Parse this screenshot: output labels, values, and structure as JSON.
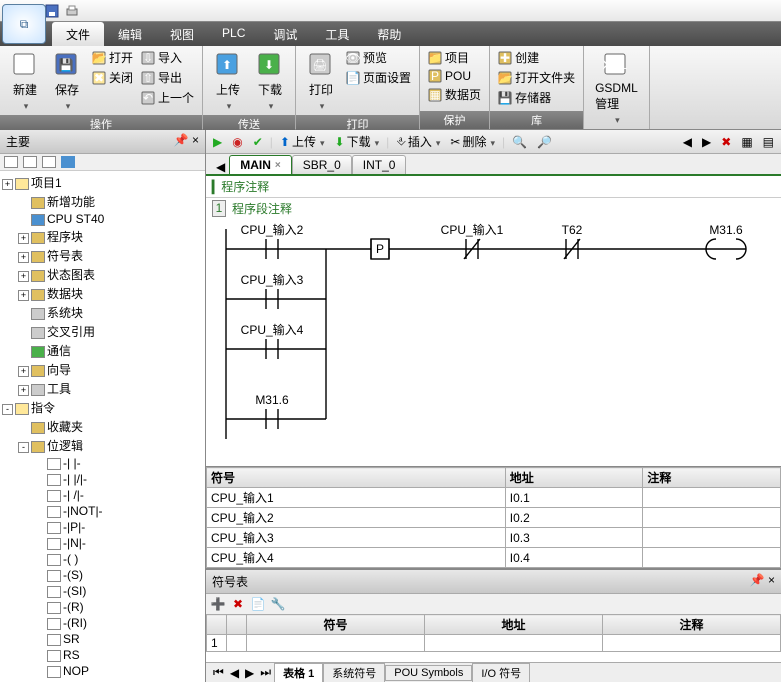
{
  "qa": {
    "app_logo": "⧉"
  },
  "menu": {
    "tabs": [
      "文件",
      "编辑",
      "视图",
      "PLC",
      "调试",
      "工具",
      "帮助"
    ],
    "active": 0
  },
  "ribbon": {
    "groups": [
      {
        "title": "操作",
        "big": [
          {
            "id": "new",
            "label": "新建"
          },
          {
            "id": "save",
            "label": "保存"
          }
        ],
        "col1": [
          {
            "id": "open",
            "label": "打开"
          },
          {
            "id": "close",
            "label": "关闭"
          }
        ],
        "col2": [
          {
            "id": "import",
            "label": "导入"
          },
          {
            "id": "export",
            "label": "导出"
          },
          {
            "id": "prev",
            "label": "上一个"
          }
        ]
      },
      {
        "title": "传送",
        "big": [
          {
            "id": "upload",
            "label": "上传"
          },
          {
            "id": "download",
            "label": "下载"
          }
        ]
      },
      {
        "title": "打印",
        "big": [
          {
            "id": "print",
            "label": "打印"
          }
        ],
        "col": [
          {
            "id": "preview",
            "label": "预览"
          },
          {
            "id": "page",
            "label": "页面设置"
          }
        ]
      },
      {
        "title": "保护",
        "col": [
          {
            "id": "project",
            "label": "项目"
          },
          {
            "id": "pou",
            "label": "POU"
          },
          {
            "id": "datapage",
            "label": "数据页"
          }
        ]
      },
      {
        "title": "库",
        "col": [
          {
            "id": "create",
            "label": "创建"
          },
          {
            "id": "openfolder",
            "label": "打开文件夹"
          },
          {
            "id": "storage",
            "label": "存储器"
          }
        ]
      },
      {
        "title": "GSDML",
        "big": [
          {
            "id": "gsdml",
            "label": "GSDML\n管理"
          }
        ]
      }
    ]
  },
  "left": {
    "title": "主要",
    "tree": [
      {
        "d": 0,
        "t": "+",
        "ic": "folder",
        "label": "项目1"
      },
      {
        "d": 1,
        "t": "",
        "ic": "star",
        "label": "新增功能"
      },
      {
        "d": 1,
        "t": "",
        "ic": "cpu",
        "label": "CPU ST40"
      },
      {
        "d": 1,
        "t": "+",
        "ic": "blk",
        "label": "程序块"
      },
      {
        "d": 1,
        "t": "+",
        "ic": "blk",
        "label": "符号表"
      },
      {
        "d": 1,
        "t": "+",
        "ic": "blk",
        "label": "状态图表"
      },
      {
        "d": 1,
        "t": "+",
        "ic": "blk",
        "label": "数据块"
      },
      {
        "d": 1,
        "t": "",
        "ic": "grid",
        "label": "系统块"
      },
      {
        "d": 1,
        "t": "",
        "ic": "xref",
        "label": "交叉引用"
      },
      {
        "d": 1,
        "t": "",
        "ic": "comm",
        "label": "通信"
      },
      {
        "d": 1,
        "t": "+",
        "ic": "wiz",
        "label": "向导"
      },
      {
        "d": 1,
        "t": "+",
        "ic": "tool",
        "label": "工具"
      },
      {
        "d": 0,
        "t": "-",
        "ic": "folder",
        "label": "指令"
      },
      {
        "d": 1,
        "t": "",
        "ic": "fav",
        "label": "收藏夹"
      },
      {
        "d": 1,
        "t": "-",
        "ic": "fold2",
        "label": "位逻辑"
      },
      {
        "d": 2,
        "t": "",
        "ic": "inst",
        "label": "-| |-"
      },
      {
        "d": 2,
        "t": "",
        "ic": "inst",
        "label": "-| |/|-"
      },
      {
        "d": 2,
        "t": "",
        "ic": "inst",
        "label": "-| /|-"
      },
      {
        "d": 2,
        "t": "",
        "ic": "inst",
        "label": "-|NOT|-"
      },
      {
        "d": 2,
        "t": "",
        "ic": "inst",
        "label": "-|P|-"
      },
      {
        "d": 2,
        "t": "",
        "ic": "inst",
        "label": "-|N|-"
      },
      {
        "d": 2,
        "t": "",
        "ic": "inst",
        "label": "-( )"
      },
      {
        "d": 2,
        "t": "",
        "ic": "inst",
        "label": "-(S)"
      },
      {
        "d": 2,
        "t": "",
        "ic": "inst",
        "label": "-(SI)"
      },
      {
        "d": 2,
        "t": "",
        "ic": "inst",
        "label": "-(R)"
      },
      {
        "d": 2,
        "t": "",
        "ic": "inst",
        "label": "-(RI)"
      },
      {
        "d": 2,
        "t": "",
        "ic": "inst",
        "label": "SR"
      },
      {
        "d": 2,
        "t": "",
        "ic": "inst",
        "label": "RS"
      },
      {
        "d": 2,
        "t": "",
        "ic": "inst",
        "label": "NOP"
      }
    ]
  },
  "editor": {
    "toolbar": {
      "upload": "上传",
      "download": "下载",
      "insert": "插入",
      "delete": "删除"
    },
    "tabs": [
      {
        "label": "MAIN",
        "active": true,
        "close": true
      },
      {
        "label": "SBR_0"
      },
      {
        "label": "INT_0"
      }
    ],
    "header": "程序注释",
    "seg_label": "程序段注释",
    "ladder": {
      "contacts": [
        "CPU_输入2",
        "CPU_输入3",
        "CPU_输入4",
        "M31.6"
      ],
      "mid": "P",
      "branch2": "CPU_输入1",
      "branch3": "T62",
      "coil": "M31.6"
    },
    "symtable": {
      "cols": [
        "符号",
        "地址",
        "注释"
      ],
      "rows": [
        [
          "CPU_输入1",
          "I0.1",
          ""
        ],
        [
          "CPU_输入2",
          "I0.2",
          ""
        ],
        [
          "CPU_输入3",
          "I0.3",
          ""
        ],
        [
          "CPU_输入4",
          "I0.4",
          ""
        ]
      ]
    }
  },
  "bottom": {
    "title": "符号表",
    "cols": [
      "",
      "",
      "符号",
      "地址",
      "注释"
    ],
    "row": [
      "",
      "",
      "",
      "",
      ""
    ],
    "tabs": [
      "表格 1",
      "系统符号",
      "POU Symbols",
      "I/O 符号"
    ],
    "active": 0
  }
}
